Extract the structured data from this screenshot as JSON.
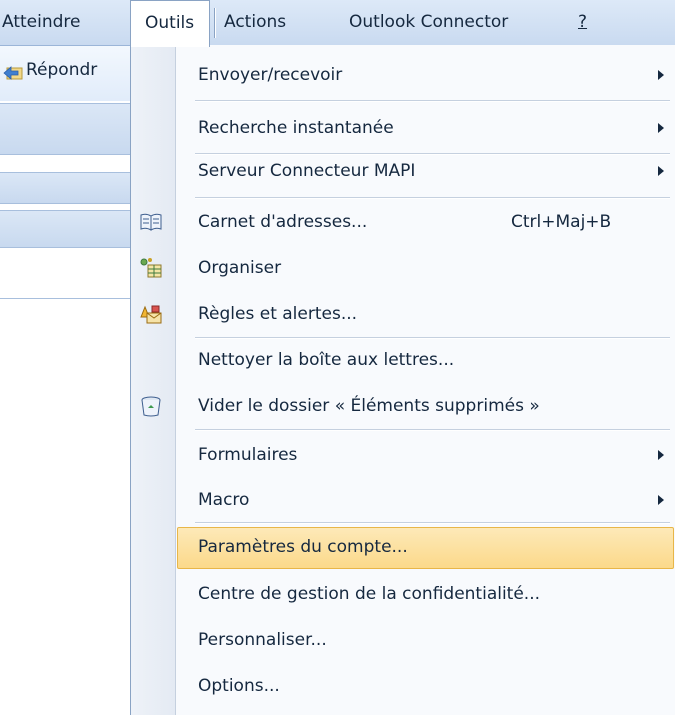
{
  "menubar": {
    "items": [
      {
        "label": "Atteindre"
      },
      {
        "label": "Outils"
      },
      {
        "label": "Actions"
      },
      {
        "label": "Outlook Connector"
      },
      {
        "label": "?"
      }
    ]
  },
  "toolbar": {
    "reply_label": "Répondr"
  },
  "menu": {
    "items": [
      {
        "label": "Envoyer/recevoir",
        "submenu": true
      },
      {
        "label": "Recherche instantanée",
        "submenu": true
      },
      {
        "label": "Serveur Connecteur MAPI",
        "submenu": true
      },
      {
        "label": "Carnet d'adresses...",
        "shortcut": "Ctrl+Maj+B",
        "icon": "address-book-icon"
      },
      {
        "label": "Organiser",
        "icon": "organize-icon"
      },
      {
        "label": "Règles et alertes...",
        "icon": "rules-alerts-icon"
      },
      {
        "label": "Nettoyer la boîte aux lettres..."
      },
      {
        "label": "Vider le dossier « Éléments supprimés »",
        "icon": "empty-trash-icon"
      },
      {
        "label": "Formulaires",
        "submenu": true
      },
      {
        "label": "Macro",
        "submenu": true
      },
      {
        "label": "Paramètres du compte...",
        "highlighted": true
      },
      {
        "label": "Centre de gestion de la confidentialité..."
      },
      {
        "label": "Personnaliser..."
      },
      {
        "label": "Options..."
      }
    ]
  },
  "colors": {
    "highlight": "#fbd98a",
    "menubar": "#c9daf0",
    "text": "#15283f"
  }
}
